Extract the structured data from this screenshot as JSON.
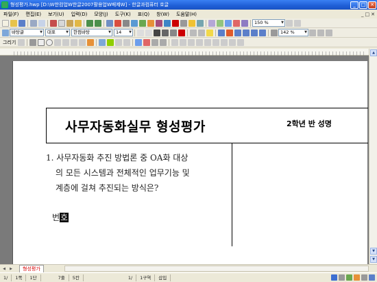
{
  "window": {
    "title": "형성평가.hwp [D:\\W한컴업W한글2007활용업W배제W] - 한글과컴퓨터 호글",
    "minimize": "_",
    "maximize": "□",
    "close": "✕"
  },
  "menu": {
    "items": [
      "파일(F)",
      "편집(E)",
      "보기(U)",
      "입력(D)",
      "모양(J)",
      "도구(K)",
      "표(Q)",
      "창(W)",
      "도움말(H)"
    ],
    "doc_controls": [
      "_",
      "□",
      "✕"
    ]
  },
  "toolbar2": {
    "style": "바탕글",
    "font_lang": "대표",
    "font": "한컴바탕",
    "size": "14",
    "zoom": "142 %"
  },
  "toolbar1": {
    "zoom": "150 %"
  },
  "toolbar3": {
    "draw_label": "그리기"
  },
  "document": {
    "title": "사무자동화실무 형성평가",
    "class_line": "2학년    반 성명",
    "question_lines": [
      "1. 사무자동화 추진 방법론 중 OA화 대상",
      "   의 모든 시스템과 전체적인 업무기능 및",
      "   계층에 걸쳐 추진되는 방식은?"
    ],
    "answer_prefix": "번",
    "answer_cursor": "호"
  },
  "tabs": {
    "active": "형성평가"
  },
  "status": {
    "cells": [
      "1/",
      "1쪽",
      "1단",
      "7줄",
      "5칸",
      "1/",
      "1구역",
      "삽입"
    ]
  },
  "colors": {
    "titlebar": "#1f5fd6",
    "tab_text": "#d60000",
    "workspace": "#7a7a7a"
  }
}
